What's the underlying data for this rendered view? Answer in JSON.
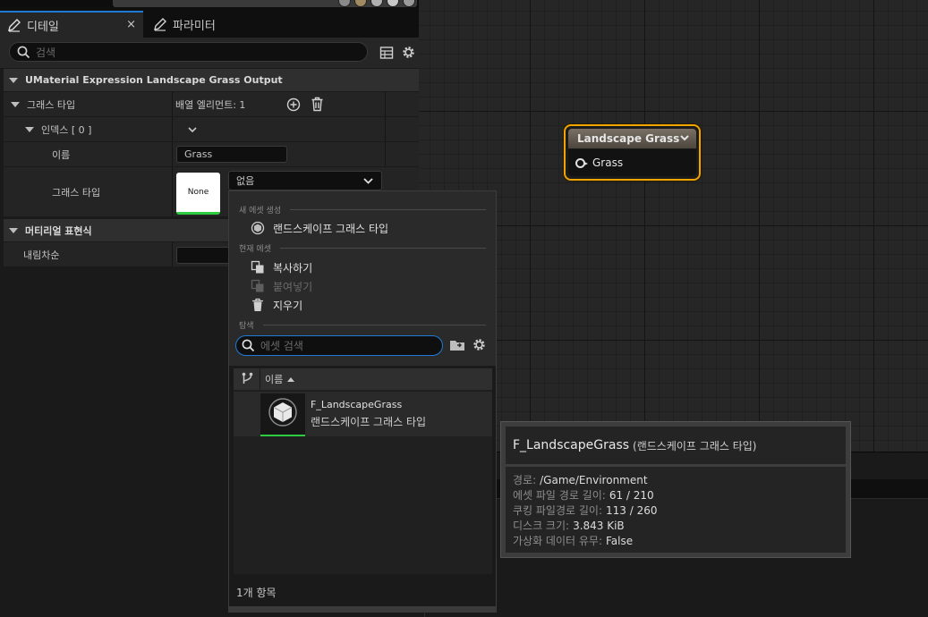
{
  "tabs": [
    {
      "label": "디테일",
      "close": "×"
    },
    {
      "label": "파라미터"
    }
  ],
  "search": {
    "placeholder": "검색"
  },
  "details": {
    "class_header": "UMaterial Expression Landscape Grass Output",
    "grass_type_label": "그래스 타입",
    "array_elements": "배열 엘리먼트: 1",
    "index_label": "인덱스 [ 0 ]",
    "name_label": "이름",
    "name_value": "Grass",
    "grass_type_label2": "그래스 타입",
    "thumb_none": "None",
    "combo_value": "없음",
    "material_expr_header": "머티리얼 표현식",
    "desc_label": "내림차순"
  },
  "menu": {
    "section_create": "새 에셋 생성",
    "create_item": "랜드스케이프 그래스 타입",
    "section_current": "현재 에셋",
    "copy": "복사하기",
    "paste": "붙여넣기",
    "clear": "지우기",
    "section_browse": "탐색",
    "search_placeholder": "에셋 검색",
    "column_name": "이름",
    "asset_name": "F_LandscapeGrass",
    "asset_type": "랜드스케이프 그래스 타입",
    "item_count": "1개 항목"
  },
  "tooltip": {
    "title": "F_LandscapeGrass",
    "type": "(랜드스케이프 그래스 타입)",
    "rows": [
      {
        "key": "경로:",
        "value": "/Game/Environment"
      },
      {
        "key": "에셋 파일 경로 길이:",
        "value": "61 / 210"
      },
      {
        "key": "쿠킹 파일경로 길이:",
        "value": "113 / 260"
      },
      {
        "key": "디스크 크기:",
        "value": "3.843 KiB"
      },
      {
        "key": "가상화 데이터 유무:",
        "value": "False"
      }
    ]
  },
  "node": {
    "title": "Landscape Grass",
    "pin": "Grass"
  },
  "colors": {
    "accent": "#1f7bd6",
    "node_border": "#f0a600",
    "asset_green": "#2ecc40"
  }
}
